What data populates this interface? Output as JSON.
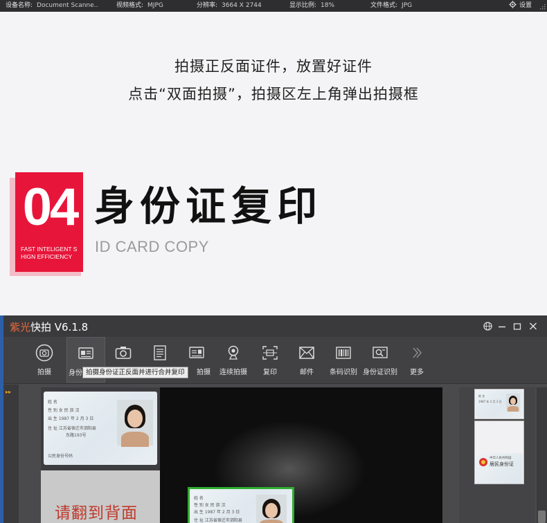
{
  "status_bar": {
    "device_label": "设备名称:",
    "device_value": "Document Scanne..",
    "format_label": "视频格式:",
    "format_value": "MJPG",
    "resolution_label": "分辨率:",
    "resolution_value": "3664 X 2744",
    "zoom_label": "显示比例:",
    "zoom_value": "18%",
    "filetype_label": "文件格式:",
    "filetype_value": "JPG",
    "settings_label": "设置",
    "settings_icon": "gear-icon"
  },
  "intro": {
    "line1": "拍摄正反面证件，放置好证件",
    "line2": "点击“双面拍摄”，拍摄区左上角弹出拍摄框"
  },
  "section": {
    "number": "04",
    "tagline_1": "FAST INTELIGENT S",
    "tagline_2": "HIGN EFFICIENCY",
    "title": "身份证复印",
    "subtitle": "ID CARD COPY",
    "accent_color": "#e8153a"
  },
  "app": {
    "brand": "紫光",
    "title_rest": "快拍 V6.1.8",
    "tooltip": "拍摄身份证正反面并进行合并复印",
    "toolbar": [
      {
        "label": "拍摄",
        "icon": "camera-lens-icon"
      },
      {
        "label": "身份",
        "icon": "id-card-icon"
      },
      {
        "label": "",
        "icon": "camera-icon"
      },
      {
        "label": "",
        "icon": "document-icon"
      },
      {
        "label": "拍摄",
        "icon": "id-card-icon"
      },
      {
        "label": "连续拍摄",
        "icon": "webcam-icon"
      },
      {
        "label": "复印",
        "icon": "copy-frame-icon"
      },
      {
        "label": "邮件",
        "icon": "mail-icon"
      },
      {
        "label": "条码识别",
        "icon": "barcode-icon"
      },
      {
        "label": "身份证识别",
        "icon": "id-recognize-icon"
      },
      {
        "label": "更多",
        "icon": "chevron-double-right-icon"
      }
    ],
    "flip_prompt": "请翻到背面",
    "window_controls": [
      "globe-icon",
      "minimize-icon",
      "maximize-icon",
      "close-icon"
    ]
  },
  "id_card_text": {
    "name_label": "姓 名",
    "sex_label": "性 别",
    "sex_value": "女",
    "ethnic_label": "民 族",
    "ethnic_value": "汉",
    "birth_label": "出 生",
    "birth_value": "1987 年 2 月 3 日",
    "address_label": "住 址",
    "address_value_1": "江苏省宿迁市泗阳县",
    "address_value_2": "东路193号",
    "id_number_label": "公民身份号码",
    "back_country": "中华人民共和国",
    "back_title": "居民身份证"
  }
}
